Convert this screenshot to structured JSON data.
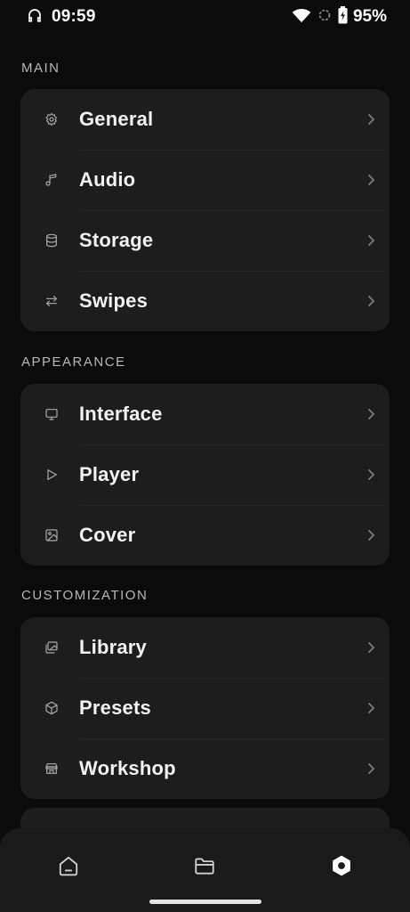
{
  "status_bar": {
    "time": "09:59",
    "battery": "95%",
    "icons": [
      "headphones-icon",
      "wifi-icon",
      "signal-icon",
      "battery-charging-icon"
    ]
  },
  "sections": [
    {
      "title": "MAIN",
      "items": [
        {
          "label": "General",
          "icon": "gear-icon"
        },
        {
          "label": "Audio",
          "icon": "music-note-icon"
        },
        {
          "label": "Storage",
          "icon": "database-icon"
        },
        {
          "label": "Swipes",
          "icon": "swap-arrows-icon"
        }
      ]
    },
    {
      "title": "APPEARANCE",
      "items": [
        {
          "label": "Interface",
          "icon": "monitor-icon"
        },
        {
          "label": "Player",
          "icon": "play-icon"
        },
        {
          "label": "Cover",
          "icon": "image-icon"
        }
      ]
    },
    {
      "title": "CUSTOMIZATION",
      "items": [
        {
          "label": "Library",
          "icon": "images-stack-icon"
        },
        {
          "label": "Presets",
          "icon": "box-icon"
        },
        {
          "label": "Workshop",
          "icon": "store-icon"
        }
      ]
    }
  ],
  "bottom_nav": {
    "items": [
      {
        "icon": "home-icon"
      },
      {
        "icon": "folder-icon"
      },
      {
        "icon": "settings-hexagon-icon",
        "active": true
      }
    ]
  },
  "colors": {
    "background": "#0b0b0b",
    "card": "#1d1d1d",
    "section_text": "#b8b8b8",
    "label_text": "#f2f2f2"
  }
}
